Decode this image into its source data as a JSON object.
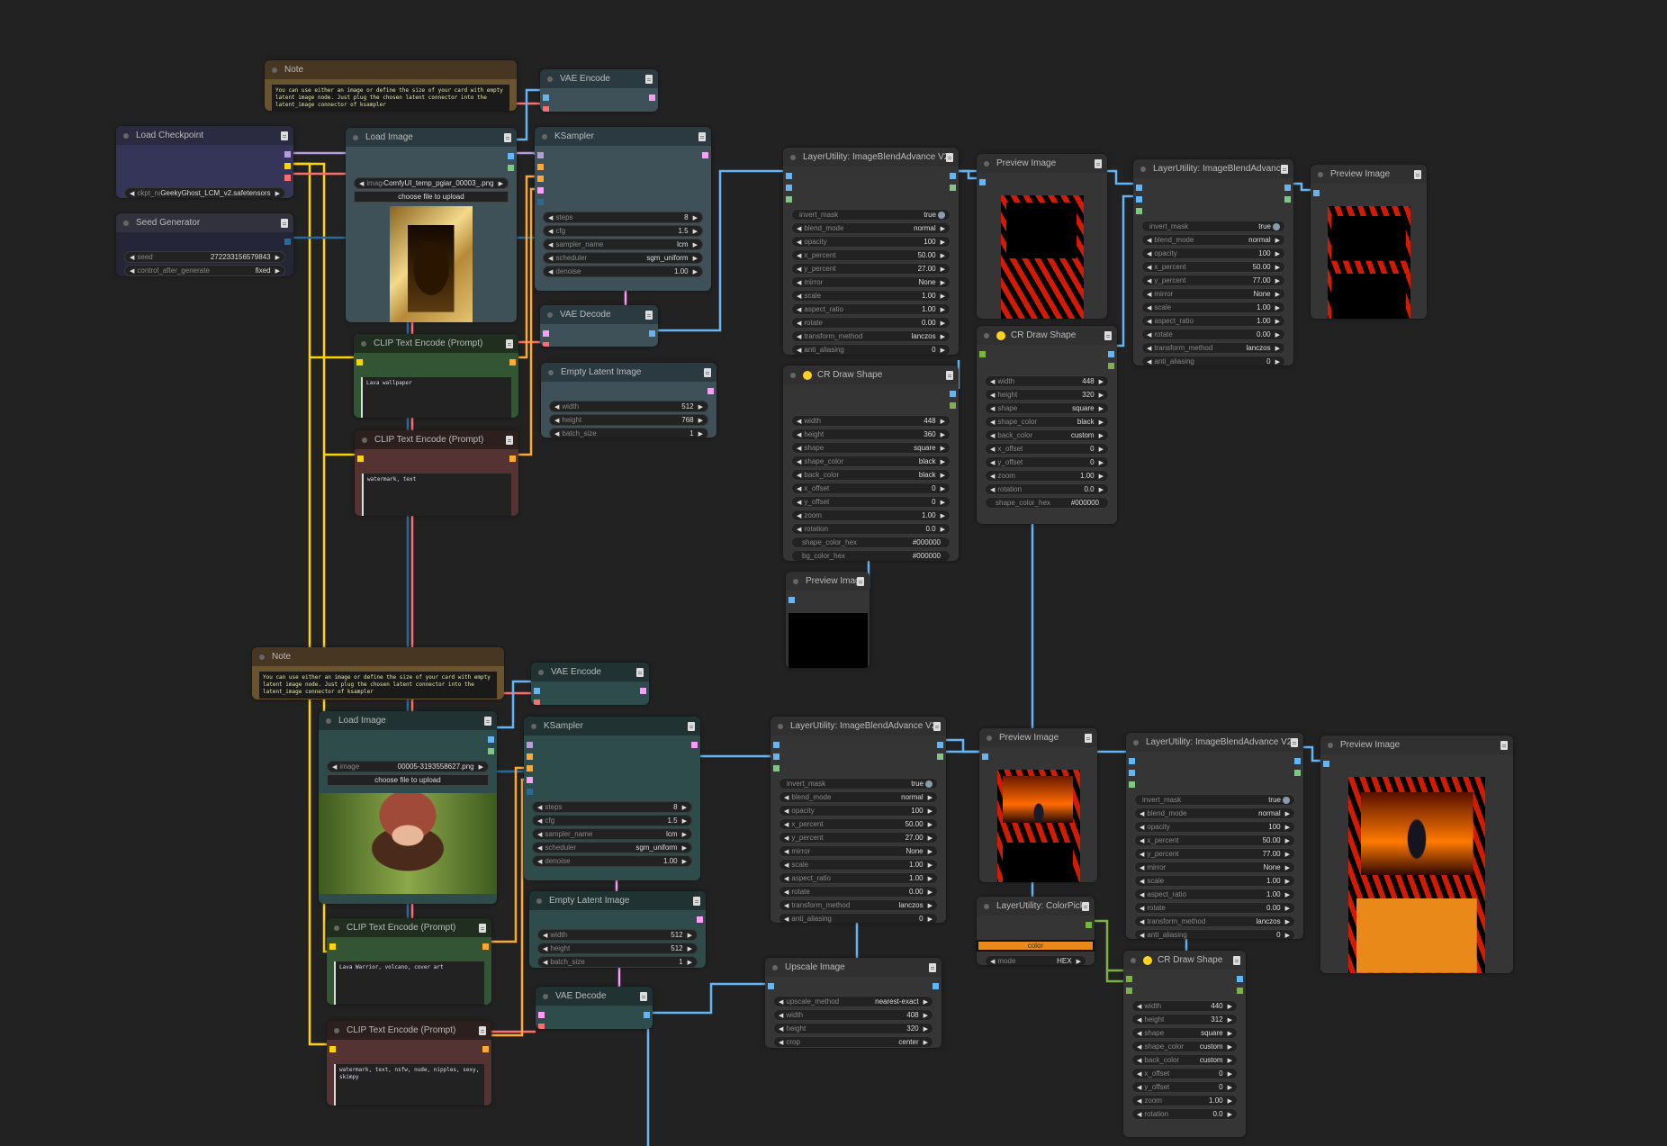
{
  "nodes": [
    {
      "id": "note1",
      "title": "Note",
      "text": "You can use either an image or define the size of your card with empty latent image node. Just plug the chosen latent connector into the latent_image connector of ksampler"
    },
    {
      "id": "vaeenc1",
      "title": "VAE Encode"
    },
    {
      "id": "ckpt",
      "title": "Load Checkpoint",
      "widgets": [
        {
          "label": "ckpt_nam",
          "value": "GeekyGhost_LCM_v2.safetensors"
        }
      ]
    },
    {
      "id": "seed",
      "title": "Seed Generator",
      "widgets": [
        {
          "label": "seed",
          "value": "272233156579843"
        },
        {
          "label": "control_after_generate",
          "value": "fixed"
        }
      ]
    },
    {
      "id": "load1",
      "title": "Load Image",
      "widgets": [
        {
          "label": "image",
          "value": "ComfyUI_temp_pgiar_00003_.png"
        }
      ],
      "button": "choose file to upload"
    },
    {
      "id": "ks1",
      "title": "KSampler",
      "widgets": [
        {
          "label": "steps",
          "value": "8"
        },
        {
          "label": "cfg",
          "value": "1.5"
        },
        {
          "label": "sampler_name",
          "value": "lcm"
        },
        {
          "label": "scheduler",
          "value": "sgm_uniform"
        },
        {
          "label": "denoise",
          "value": "1.00"
        }
      ]
    },
    {
      "id": "vaedec1",
      "title": "VAE Decode"
    },
    {
      "id": "clipg1",
      "title": "CLIP Text Encode (Prompt)",
      "text": "Lava wallpaper"
    },
    {
      "id": "latent1",
      "title": "Empty Latent Image",
      "widgets": [
        {
          "label": "width",
          "value": "512"
        },
        {
          "label": "height",
          "value": "768"
        },
        {
          "label": "batch_size",
          "value": "1"
        }
      ]
    },
    {
      "id": "clipr1",
      "title": "CLIP Text Encode (Prompt)",
      "text": "watermark, text"
    },
    {
      "id": "blend1",
      "title": "LayerUtility: ImageBlendAdvance V2",
      "widgets": [
        {
          "label": "invert_mask",
          "value": "true",
          "kind": "toggle"
        },
        {
          "label": "blend_mode",
          "value": "normal"
        },
        {
          "label": "opacity",
          "value": "100"
        },
        {
          "label": "x_percent",
          "value": "50.00"
        },
        {
          "label": "y_percent",
          "value": "27.00"
        },
        {
          "label": "mirror",
          "value": "None"
        },
        {
          "label": "scale",
          "value": "1.00"
        },
        {
          "label": "aspect_ratio",
          "value": "1.00"
        },
        {
          "label": "rotate",
          "value": "0.00"
        },
        {
          "label": "transform_method",
          "value": "lanczos"
        },
        {
          "label": "anti_aliasing",
          "value": "0"
        }
      ]
    },
    {
      "id": "prev1",
      "title": "Preview Image"
    },
    {
      "id": "shape2",
      "title": "CR Draw Shape",
      "widgets": [
        {
          "label": "width",
          "value": "448"
        },
        {
          "label": "height",
          "value": "320"
        },
        {
          "label": "shape",
          "value": "square"
        },
        {
          "label": "shape_color",
          "value": "black"
        },
        {
          "label": "back_color",
          "value": "custom"
        },
        {
          "label": "x_offset",
          "value": "0"
        },
        {
          "label": "y_offset",
          "value": "0"
        },
        {
          "label": "zoom",
          "value": "1.00"
        },
        {
          "label": "rotation",
          "value": "0.0"
        },
        {
          "label": "shape_color_hex",
          "value": "#000000",
          "kind": "text"
        }
      ]
    },
    {
      "id": "blend2",
      "title": "LayerUtility: ImageBlendAdvance V2",
      "widgets": [
        {
          "label": "invert_mask",
          "value": "true",
          "kind": "toggle"
        },
        {
          "label": "blend_mode",
          "value": "normal"
        },
        {
          "label": "opacity",
          "value": "100"
        },
        {
          "label": "x_percent",
          "value": "50.00"
        },
        {
          "label": "y_percent",
          "value": "77.00"
        },
        {
          "label": "mirror",
          "value": "None"
        },
        {
          "label": "scale",
          "value": "1.00"
        },
        {
          "label": "aspect_ratio",
          "value": "1.00"
        },
        {
          "label": "rotate",
          "value": "0.00"
        },
        {
          "label": "transform_method",
          "value": "lanczos"
        },
        {
          "label": "anti_aliasing",
          "value": "0"
        }
      ]
    },
    {
      "id": "prev2",
      "title": "Preview Image"
    },
    {
      "id": "shape1",
      "title": "CR Draw Shape",
      "widgets": [
        {
          "label": "width",
          "value": "448"
        },
        {
          "label": "height",
          "value": "360"
        },
        {
          "label": "shape",
          "value": "square"
        },
        {
          "label": "shape_color",
          "value": "black"
        },
        {
          "label": "back_color",
          "value": "black"
        },
        {
          "label": "x_offset",
          "value": "0"
        },
        {
          "label": "y_offset",
          "value": "0"
        },
        {
          "label": "zoom",
          "value": "1.00"
        },
        {
          "label": "rotation",
          "value": "0.0"
        },
        {
          "label": "shape_color_hex",
          "value": "#000000",
          "kind": "text"
        },
        {
          "label": "bg_color_hex",
          "value": "#000000",
          "kind": "text"
        }
      ]
    },
    {
      "id": "prev3",
      "title": "Preview Image"
    },
    {
      "id": "note2",
      "title": "Note",
      "text": "You can use either an image or define the size of your card with empty latent image node. Just plug the chosen latent connector into the latent_image connector of ksampler"
    },
    {
      "id": "vaeenc2",
      "title": "VAE Encode"
    },
    {
      "id": "load2",
      "title": "Load Image",
      "widgets": [
        {
          "label": "image",
          "value": "00005-3193558627.png"
        }
      ],
      "button": "choose file to upload"
    },
    {
      "id": "ks2",
      "title": "KSampler",
      "widgets": [
        {
          "label": "steps",
          "value": "8"
        },
        {
          "label": "cfg",
          "value": "1.5"
        },
        {
          "label": "sampler_name",
          "value": "lcm"
        },
        {
          "label": "scheduler",
          "value": "sgm_uniform"
        },
        {
          "label": "denoise",
          "value": "1.00"
        }
      ]
    },
    {
      "id": "clipg2",
      "title": "CLIP Text Encode (Prompt)",
      "text": "Lava Warrior, volcano, cover art"
    },
    {
      "id": "latent2",
      "title": "Empty Latent Image",
      "widgets": [
        {
          "label": "width",
          "value": "512"
        },
        {
          "label": "height",
          "value": "512"
        },
        {
          "label": "batch_size",
          "value": "1"
        }
      ]
    },
    {
      "id": "clipr2",
      "title": "CLIP Text Encode (Prompt)",
      "text": "watermark, text, nsfw, nude, nipples, sexy, skimpy"
    },
    {
      "id": "vaedec2",
      "title": "VAE Decode"
    },
    {
      "id": "blend3",
      "title": "LayerUtility: ImageBlendAdvance V2",
      "widgets": [
        {
          "label": "invert_mask",
          "value": "true",
          "kind": "toggle"
        },
        {
          "label": "blend_mode",
          "value": "normal"
        },
        {
          "label": "opacity",
          "value": "100"
        },
        {
          "label": "x_percent",
          "value": "50.00"
        },
        {
          "label": "y_percent",
          "value": "27.00"
        },
        {
          "label": "mirror",
          "value": "None"
        },
        {
          "label": "scale",
          "value": "1.00"
        },
        {
          "label": "aspect_ratio",
          "value": "1.00"
        },
        {
          "label": "rotate",
          "value": "0.00"
        },
        {
          "label": "transform_method",
          "value": "lanczos"
        },
        {
          "label": "anti_aliasing",
          "value": "0"
        }
      ]
    },
    {
      "id": "prev4",
      "title": "Preview Image"
    },
    {
      "id": "picker",
      "title": "LayerUtility: ColorPicker",
      "swatch": {
        "label": "color",
        "color": "#e8891a"
      },
      "widgets": [
        {
          "label": "mode",
          "value": "HEX"
        }
      ]
    },
    {
      "id": "upscale",
      "title": "Upscale Image",
      "widgets": [
        {
          "label": "upscale_method",
          "value": "nearest-exact"
        },
        {
          "label": "width",
          "value": "408"
        },
        {
          "label": "height",
          "value": "320"
        },
        {
          "label": "crop",
          "value": "center"
        }
      ]
    },
    {
      "id": "blend4",
      "title": "LayerUtility: ImageBlendAdvance V2",
      "widgets": [
        {
          "label": "invert_mask",
          "value": "true",
          "kind": "toggle"
        },
        {
          "label": "blend_mode",
          "value": "normal"
        },
        {
          "label": "opacity",
          "value": "100"
        },
        {
          "label": "x_percent",
          "value": "50.00"
        },
        {
          "label": "y_percent",
          "value": "77.00"
        },
        {
          "label": "mirror",
          "value": "None"
        },
        {
          "label": "scale",
          "value": "1.00"
        },
        {
          "label": "aspect_ratio",
          "value": "1.00"
        },
        {
          "label": "rotate",
          "value": "0.00"
        },
        {
          "label": "transform_method",
          "value": "lanczos"
        },
        {
          "label": "anti_aliasing",
          "value": "0"
        }
      ]
    },
    {
      "id": "prev5",
      "title": "Preview Image"
    },
    {
      "id": "shape3",
      "title": "CR Draw Shape",
      "widgets": [
        {
          "label": "width",
          "value": "440"
        },
        {
          "label": "height",
          "value": "312"
        },
        {
          "label": "shape",
          "value": "square"
        },
        {
          "label": "shape_color",
          "value": "custom"
        },
        {
          "label": "back_color",
          "value": "custom"
        },
        {
          "label": "x_offset",
          "value": "0"
        },
        {
          "label": "y_offset",
          "value": "0"
        },
        {
          "label": "zoom",
          "value": "1.00"
        },
        {
          "label": "rotation",
          "value": "0.0"
        }
      ]
    }
  ]
}
